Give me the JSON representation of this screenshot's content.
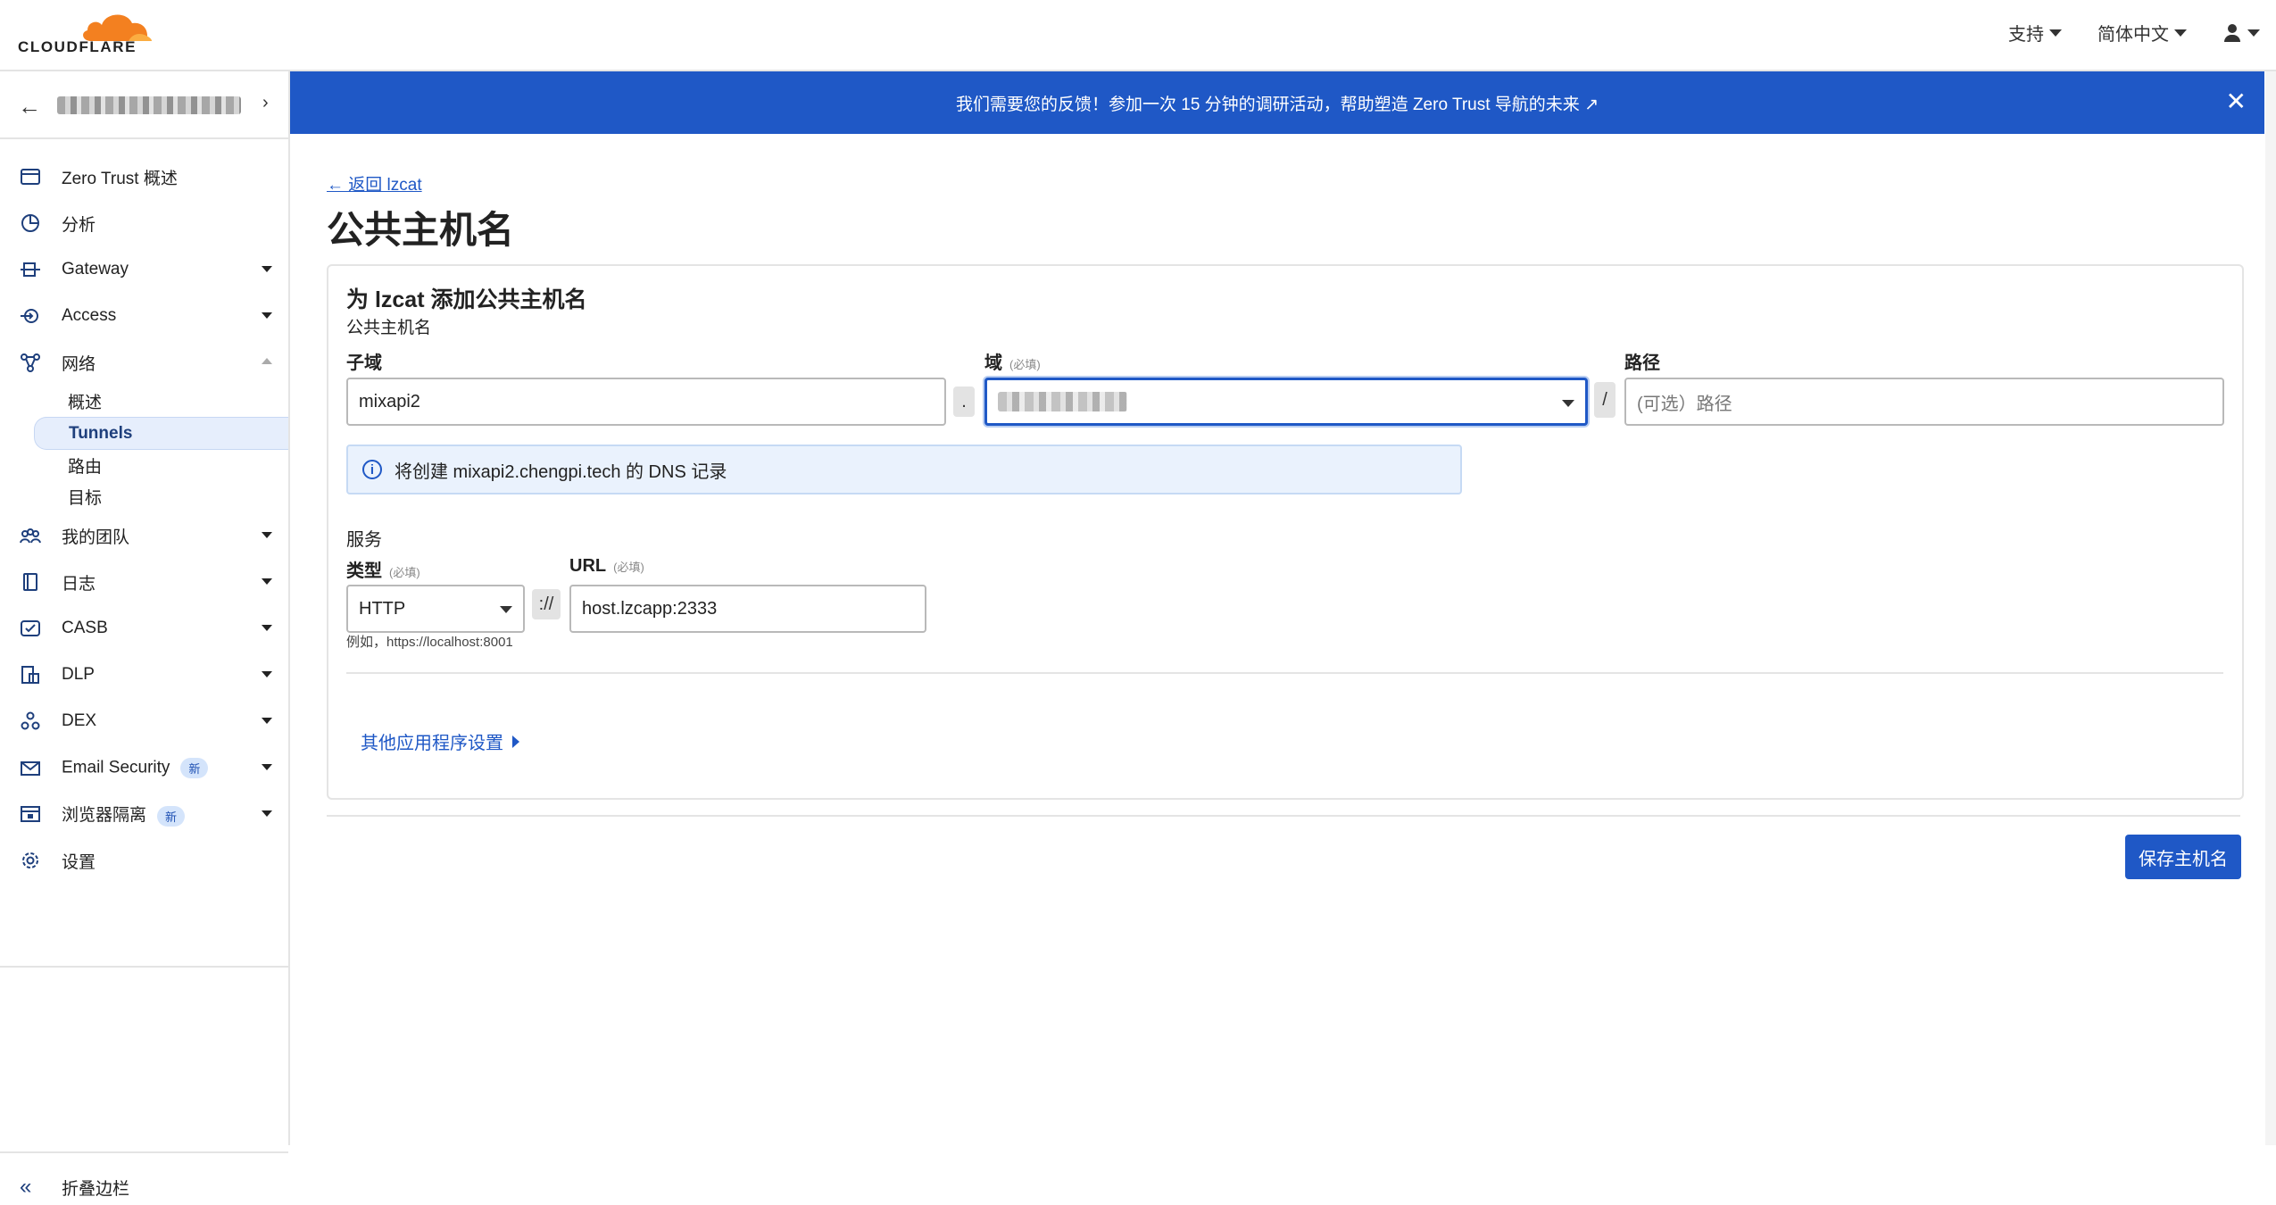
{
  "brand": {
    "name": "CLOUDFLARE",
    "accent": "#f38020",
    "primary": "#1f58c6"
  },
  "topnav": {
    "support": "支持",
    "language": "简体中文",
    "account_icon": "user-icon"
  },
  "sidebar": {
    "items": [
      {
        "label": "Zero Trust 概述",
        "icon": "overview-icon"
      },
      {
        "label": "分析",
        "icon": "analytics-icon"
      },
      {
        "label": "Gateway",
        "icon": "gateway-icon"
      },
      {
        "label": "Access",
        "icon": "access-icon"
      },
      {
        "label": "网络",
        "icon": "network-icon"
      },
      {
        "label": "我的团队",
        "icon": "team-icon"
      },
      {
        "label": "日志",
        "icon": "logs-icon"
      },
      {
        "label": "CASB",
        "icon": "casb-icon"
      },
      {
        "label": "DLP",
        "icon": "dlp-icon"
      },
      {
        "label": "DEX",
        "icon": "dex-icon"
      },
      {
        "label": "Email Security",
        "icon": "email-icon",
        "badge": "新"
      },
      {
        "label": "浏览器隔离",
        "icon": "browser-icon",
        "badge": "新"
      },
      {
        "label": "设置",
        "icon": "settings-icon"
      }
    ],
    "network_sub": [
      "概述",
      "Tunnels",
      "路由",
      "目标"
    ],
    "collapse": "折叠边栏"
  },
  "banner": {
    "text": "我们需要您的反馈！参加一次 15 分钟的调研活动，帮助塑造 Zero Trust 导航的未来 ↗"
  },
  "page": {
    "back_link": "← 返回 lzcat",
    "title": "公共主机名"
  },
  "form": {
    "card_title": "为 lzcat 添加公共主机名",
    "card_subtitle": "公共主机名",
    "subdomain": {
      "label": "子域",
      "value": "mixapi2"
    },
    "domain": {
      "label": "域",
      "required": "(必填)"
    },
    "dot": ".",
    "slash": "/",
    "path": {
      "label": "路径",
      "placeholder": "(可选）路径"
    },
    "dns_info": "将创建 mixapi2.chengpi.tech 的 DNS 记录",
    "service_label": "服务",
    "type": {
      "label": "类型",
      "required": "(必填)",
      "value": "HTTP"
    },
    "scheme_sep": "://",
    "url": {
      "label": "URL",
      "required": "(必填)",
      "value": "host.lzcapp:2333"
    },
    "hint": "例如，https://localhost:8001",
    "more_settings": "其他应用程序设置"
  },
  "actions": {
    "save": "保存主机名"
  }
}
